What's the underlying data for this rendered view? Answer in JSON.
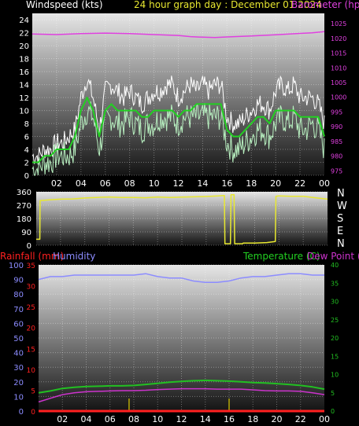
{
  "header": {
    "windspeed_title": "Windspeed (kts)",
    "graph_title": "24 hour graph day : December 01 2024",
    "barometer_title": "Barometer (hpa)"
  },
  "compass_letters": [
    "N",
    "W",
    "S",
    "E",
    "N"
  ],
  "panel3_titles": {
    "rainfall": "Rainfall (mm)",
    "humidity": "Humidity",
    "temperature": "Temperature (C)",
    "dewpoint": "Dew Point (C)"
  },
  "colors": {
    "wind_gust": "#ffffff",
    "wind_avg": "#b8f0c0",
    "wind_trend": "#22d022",
    "barometer": "#e040e0",
    "direction": "#e8e830",
    "humidity": "#8c8cff",
    "temperature": "#22c022",
    "dewpoint": "#cc33cc",
    "rainfall": "#ff2020",
    "rain_rate": "#ddcc00"
  },
  "chart_data": [
    {
      "type": "line",
      "name": "wind-and-barometer",
      "x_tick_labels": [
        "02",
        "04",
        "06",
        "08",
        "10",
        "12",
        "14",
        "16",
        "18",
        "20",
        "22",
        "00"
      ],
      "xlim": [
        0,
        24
      ],
      "y_left": {
        "label": "Windspeed (kts)",
        "ticks": [
          0,
          2,
          4,
          6,
          8,
          10,
          12,
          14,
          16,
          18,
          20,
          22,
          24
        ],
        "ylim": [
          0,
          25
        ]
      },
      "y_right": {
        "label": "Barometer (hpa)",
        "ticks": [
          975,
          980,
          985,
          990,
          995,
          1000,
          1005,
          1010,
          1015,
          1020,
          1025
        ],
        "ylim": [
          973.5,
          1028.5
        ]
      },
      "grid": true,
      "series": [
        {
          "name": "gust",
          "axis": "left",
          "x": [
            0,
            0.5,
            1,
            1.5,
            2,
            2.5,
            3,
            3.5,
            4,
            4.5,
            5,
            5.5,
            6,
            6.5,
            7,
            7.5,
            8,
            8.5,
            9,
            9.5,
            10,
            10.5,
            11,
            11.5,
            12,
            12.5,
            13,
            13.5,
            14,
            14.5,
            15,
            15.5,
            16,
            16.5,
            17,
            17.5,
            18,
            18.5,
            19,
            19.5,
            20,
            20.5,
            21,
            21.5,
            22,
            22.5,
            23,
            23.5,
            24
          ],
          "values": [
            3,
            3,
            4,
            4,
            5,
            5,
            6,
            7,
            12,
            15,
            12,
            7,
            13,
            14,
            13,
            12,
            13,
            12,
            11,
            12,
            13,
            13,
            14,
            14,
            12,
            13,
            14,
            13,
            14,
            13,
            14,
            14,
            9,
            8,
            8,
            9,
            10,
            11,
            11,
            10,
            13,
            14,
            13,
            14,
            12,
            12,
            12,
            11,
            8
          ]
        },
        {
          "name": "average",
          "axis": "left",
          "x": [
            0,
            0.5,
            1,
            1.5,
            2,
            2.5,
            3,
            3.5,
            4,
            4.5,
            5,
            5.5,
            6,
            6.5,
            7,
            7.5,
            8,
            8.5,
            9,
            9.5,
            10,
            10.5,
            11,
            11.5,
            12,
            12.5,
            13,
            13.5,
            14,
            14.5,
            15,
            15.5,
            16,
            16.5,
            17,
            17.5,
            18,
            18.5,
            19,
            19.5,
            20,
            20.5,
            21,
            21.5,
            22,
            22.5,
            23,
            23.5,
            24
          ],
          "values": [
            1,
            1,
            2,
            2,
            3,
            3,
            3,
            4,
            8,
            10,
            9,
            4,
            8,
            9,
            8,
            8,
            9,
            8,
            7,
            8,
            8,
            9,
            9,
            9,
            8,
            9,
            9,
            9,
            9,
            9,
            9,
            9,
            5,
            4,
            4,
            5,
            6,
            7,
            7,
            6,
            8,
            9,
            8,
            9,
            7,
            7,
            8,
            7,
            4
          ]
        },
        {
          "name": "trend",
          "axis": "left",
          "x": [
            0,
            0.5,
            1,
            1.5,
            2,
            2.5,
            3,
            3.5,
            4,
            4.5,
            5,
            5.5,
            6,
            6.5,
            7,
            7.5,
            8,
            8.5,
            9,
            9.5,
            10,
            10.5,
            11,
            11.5,
            12,
            12.5,
            13,
            13.5,
            14,
            14.5,
            15,
            15.5,
            16,
            16.5,
            17,
            17.5,
            18,
            18.5,
            19,
            19.5,
            20,
            20.5,
            21,
            21.5,
            22,
            22.5,
            23,
            23.5,
            24
          ],
          "values": [
            2,
            2,
            3,
            3,
            4,
            4,
            4,
            6,
            10,
            12,
            10,
            6,
            10,
            11,
            10,
            10,
            10,
            10,
            9,
            9,
            10,
            10,
            10,
            10,
            9,
            10,
            10,
            11,
            11,
            11,
            11,
            11,
            7,
            6,
            6,
            7,
            8,
            9,
            9,
            8,
            10,
            10,
            10,
            10,
            9,
            9,
            9,
            9,
            6
          ]
        },
        {
          "name": "barometer",
          "axis": "right",
          "x": [
            0,
            2,
            4,
            6,
            8,
            10,
            12,
            13,
            14,
            15,
            16,
            18,
            20,
            22,
            23,
            24
          ],
          "values": [
            1021.5,
            1021.3,
            1021.6,
            1021.8,
            1021.6,
            1021.3,
            1021.0,
            1020.6,
            1020.4,
            1020.3,
            1020.5,
            1020.8,
            1021.2,
            1021.7,
            1021.9,
            1022.3
          ]
        }
      ]
    },
    {
      "type": "line",
      "name": "wind-direction",
      "xlim": [
        0,
        24
      ],
      "y_left": {
        "ticks": [
          0,
          90,
          180,
          270,
          360
        ],
        "ylim": [
          0,
          360
        ]
      },
      "grid": true,
      "series": [
        {
          "name": "direction",
          "x": [
            0,
            0.3,
            0.32,
            1,
            2,
            3,
            4,
            5,
            6,
            7,
            8,
            9,
            10,
            11,
            12,
            13,
            14,
            15,
            15.5,
            15.55,
            16,
            16.05,
            16.3,
            16.35,
            17,
            17.05,
            18,
            19,
            19.7,
            19.75,
            20,
            21,
            22,
            23,
            24
          ],
          "values": [
            40,
            40,
            300,
            305,
            310,
            312,
            318,
            322,
            325,
            322,
            322,
            320,
            325,
            322,
            324,
            326,
            328,
            332,
            335,
            10,
            10,
            340,
            340,
            10,
            10,
            15,
            15,
            18,
            25,
            330,
            332,
            330,
            330,
            320,
            310
          ]
        }
      ]
    },
    {
      "type": "line",
      "name": "rain-humidity-temperature",
      "x_tick_labels": [
        "02",
        "04",
        "06",
        "08",
        "10",
        "12",
        "14",
        "16",
        "18",
        "20",
        "22",
        "00"
      ],
      "xlim": [
        0,
        24
      ],
      "y_left_rain": {
        "label": "Rainfall (mm)",
        "ticks": [
          0,
          5,
          10,
          15,
          20,
          25,
          30,
          35
        ],
        "ylim": [
          0,
          35
        ]
      },
      "y_left_humidity": {
        "label": "Humidity",
        "ticks": [
          0,
          10,
          20,
          30,
          40,
          50,
          60,
          70,
          80,
          90,
          100
        ],
        "ylim": [
          0,
          100
        ]
      },
      "y_right": {
        "label": "Temperature (C) / Dew Point (C)",
        "ticks": [
          0,
          5,
          10,
          15,
          20,
          25,
          30,
          35,
          40
        ],
        "ylim": [
          0,
          40
        ]
      },
      "grid": true,
      "series": [
        {
          "name": "humidity",
          "axis": "left_humidity",
          "x": [
            0,
            1,
            2,
            3,
            4,
            5,
            6,
            7,
            8,
            9,
            10,
            11,
            12,
            13,
            14,
            15,
            16,
            17,
            18,
            19,
            20,
            21,
            22,
            23,
            24
          ],
          "values": [
            90,
            92,
            92,
            93,
            93,
            93,
            93,
            93,
            93,
            94,
            92,
            91,
            91,
            89,
            88,
            88,
            89,
            91,
            92,
            92,
            93,
            94,
            94,
            93,
            93
          ]
        },
        {
          "name": "temperature",
          "axis": "right",
          "x": [
            0,
            1,
            2,
            3,
            4,
            5,
            6,
            7,
            8,
            9,
            10,
            11,
            12,
            13,
            14,
            15,
            16,
            17,
            18,
            19,
            20,
            21,
            22,
            23,
            24
          ],
          "values": [
            5.0,
            5.5,
            6.2,
            6.5,
            6.7,
            6.8,
            6.9,
            6.9,
            7.0,
            7.3,
            7.6,
            7.9,
            8.1,
            8.3,
            8.4,
            8.3,
            8.2,
            8.0,
            7.8,
            7.7,
            7.5,
            7.3,
            7.0,
            6.6,
            6.0
          ]
        },
        {
          "name": "dewpoint",
          "axis": "right",
          "x": [
            0,
            1,
            2,
            3,
            4,
            5,
            6,
            7,
            8,
            9,
            10,
            11,
            12,
            13,
            14,
            15,
            16,
            17,
            18,
            19,
            20,
            21,
            22,
            23,
            24
          ],
          "values": [
            2.5,
            3.5,
            4.5,
            5.0,
            5.3,
            5.4,
            5.5,
            5.6,
            5.6,
            5.7,
            5.9,
            6.0,
            6.1,
            6.1,
            6.1,
            6.0,
            6.0,
            6.0,
            5.8,
            5.6,
            5.5,
            5.5,
            5.4,
            5.0,
            4.5
          ]
        },
        {
          "name": "rain-rate-spikes",
          "axis": "left_rain",
          "x": [
            7.6,
            7.6,
            16.0,
            16.0
          ],
          "values": [
            0,
            3,
            0,
            3
          ]
        },
        {
          "name": "rainfall",
          "axis": "left_rain",
          "x": [
            0,
            24
          ],
          "values": [
            0,
            0
          ]
        }
      ]
    }
  ]
}
